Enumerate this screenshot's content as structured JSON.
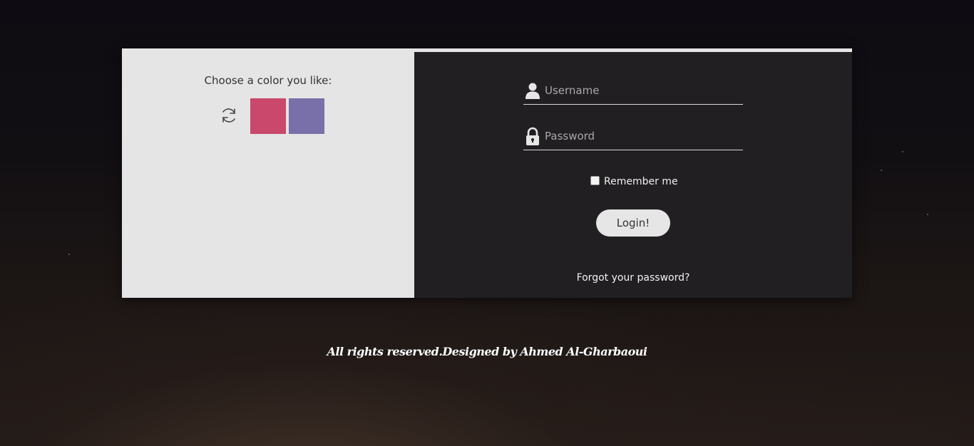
{
  "colors": {
    "left_panel_bg": "#e5e5e5",
    "right_panel_bg": "#211f21",
    "swatch_pink": "#c9486b",
    "swatch_purple": "#7a70a9",
    "button_bg": "#e6e6e6"
  },
  "color_picker": {
    "title": "Choose a color you like:",
    "refresh_icon": "refresh-icon",
    "swatches": [
      {
        "name": "pink",
        "color": "#c9486b"
      },
      {
        "name": "purple",
        "color": "#7a70a9"
      }
    ]
  },
  "login_form": {
    "username": {
      "placeholder": "Username",
      "value": "",
      "icon": "user-icon"
    },
    "password": {
      "placeholder": "Password",
      "value": "",
      "icon": "lock-icon"
    },
    "remember_label": "Remember me",
    "remember_checked": false,
    "login_button": "Login!",
    "forgot_link": "Forgot your password?"
  },
  "footer": {
    "text": "All rights reserved.Designed by Ahmed Al-Gharbaoui"
  }
}
